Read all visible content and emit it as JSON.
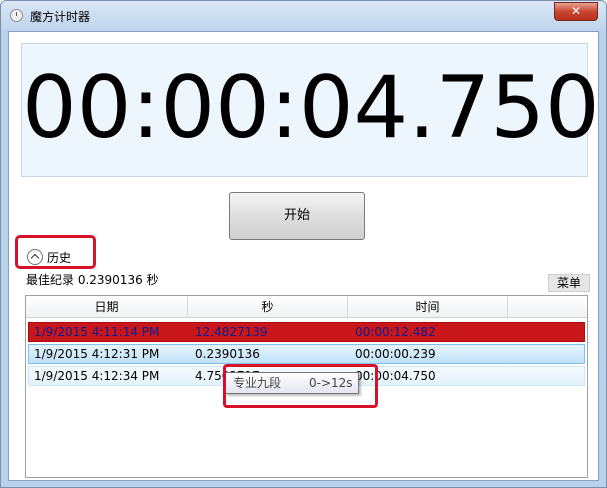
{
  "window": {
    "title": "魔方计时器",
    "close_label": "✕"
  },
  "timer": {
    "display": "00:00:04.750"
  },
  "controls": {
    "start_label": "开始"
  },
  "history": {
    "label": "历史",
    "best_record": "最佳纪录 0.2390136 秒",
    "menu_label": "菜单",
    "columns": [
      "日期",
      "秒",
      "时间"
    ],
    "rows": [
      {
        "date": "1/9/2015 4:11:14 PM",
        "seconds": "12.4827139",
        "time": "00:00:12.482",
        "state": "highlighted-red"
      },
      {
        "date": "1/9/2015 4:12:31 PM",
        "seconds": "0.2390136",
        "time": "00:00:00.239",
        "state": "selected"
      },
      {
        "date": "1/9/2015 4:12:34 PM",
        "seconds": "4.7502717",
        "time": "00:00:04.750",
        "state": "hover"
      }
    ]
  },
  "tooltip": {
    "level": "专业九段",
    "range": "0->12s"
  },
  "colors": {
    "red_row": "#c9161b",
    "annotation_red": "#d8102a",
    "selected_row": "#bfe2f7"
  }
}
